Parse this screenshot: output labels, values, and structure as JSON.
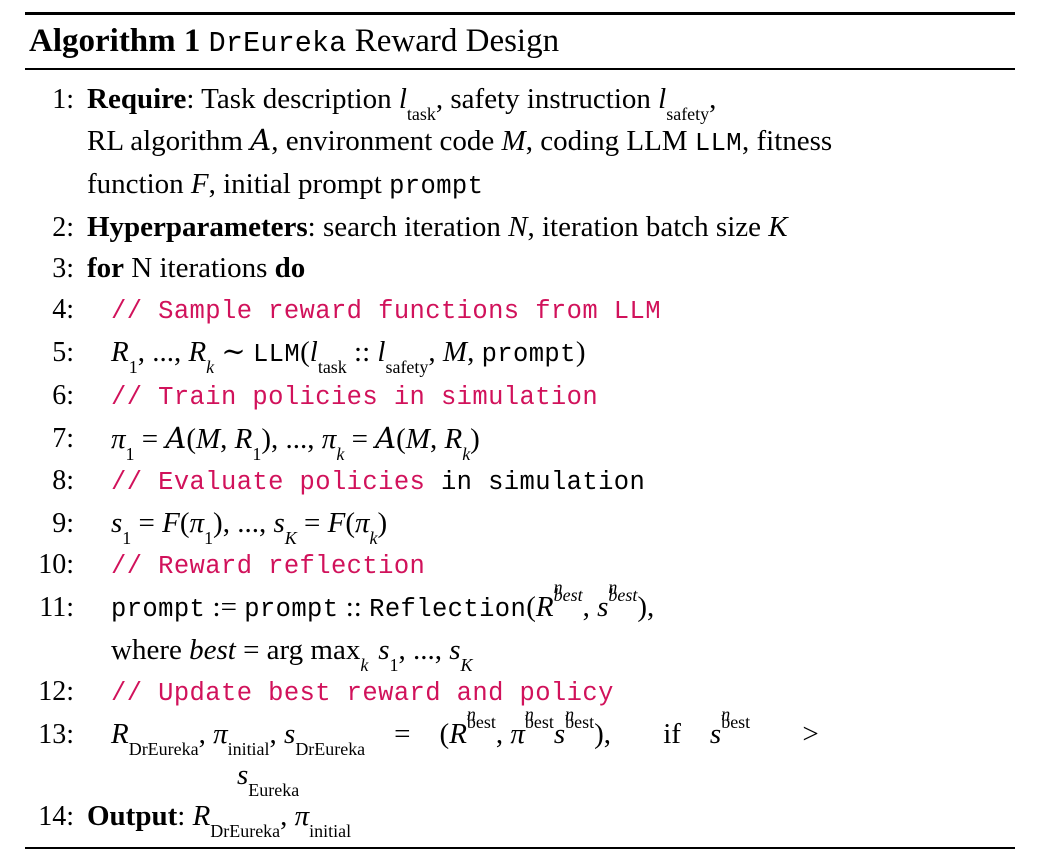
{
  "algorithm": {
    "keyword": "Algorithm",
    "number": "1",
    "name": "DrEureka",
    "title_suffix": "Reward Design",
    "comment_color": "#D1125B",
    "rules": {
      "top": "thick",
      "mid": "medium",
      "bottom": "thin"
    },
    "lines": [
      {
        "num": "1:",
        "type": "require",
        "label": "Require",
        "text_1": ": Task description ",
        "var_l1": "l",
        "sub_l1": "task",
        "text_2": ", safety instruction ",
        "var_l2": "l",
        "sub_l2": "safety",
        "text_3": ",",
        "cont_1_a": "RL algorithm ",
        "cont_1_cal": "A",
        "cont_1_b": ", environment code ",
        "cont_1_M": "M",
        "cont_1_c": ", coding LLM ",
        "cont_1_tt": "LLM",
        "cont_1_d": ", fitness",
        "cont_2_a": "function ",
        "cont_2_F": "F",
        "cont_2_b": ", initial prompt ",
        "cont_2_tt": "prompt"
      },
      {
        "num": "2:",
        "type": "hyperparameters",
        "label": "Hyperparameters",
        "text_1": ": search iteration ",
        "var_N": "N",
        "text_2": ", iteration batch size ",
        "var_K": "K"
      },
      {
        "num": "3:",
        "type": "for",
        "kw_for": "for",
        "text_1": " N iterations ",
        "kw_do": "do"
      },
      {
        "num": "4:",
        "type": "comment",
        "comment": "// Sample reward functions from LLM"
      },
      {
        "num": "5:",
        "type": "math",
        "R": "R",
        "sub_R1": "1",
        "dots": ", ..., ",
        "R2": "R",
        "sub_Rk": "k",
        "sim": " ∼ ",
        "llm": "LLM",
        "paren_open": "(",
        "l1": "l",
        "sub_l1": "task",
        "cc": " :: ",
        "l2": "l",
        "sub_l2": "safety",
        "comma1": ", ",
        "M": "M",
        "comma2": ", ",
        "prompt": "prompt",
        "paren_close": ")"
      },
      {
        "num": "6:",
        "type": "comment",
        "comment": "// Train policies in simulation"
      },
      {
        "num": "7:",
        "type": "math",
        "pi1": "π",
        "sub_pi1": "1",
        "eq1": " = ",
        "cal1": "A",
        "args1": "(",
        "M1": "M",
        "c1": ", ",
        "Rr1": "R",
        "sub_Rr1": "1",
        "cl1": ")",
        "dots": ", ..., ",
        "pik": "π",
        "sub_pik": "k",
        "eq2": " = ",
        "cal2": "A",
        "args2": "(",
        "M2": "M",
        "c2": ", ",
        "Rr2": "R",
        "sub_Rr2": "k",
        "cl2": ")"
      },
      {
        "num": "8:",
        "type": "comment-mixed",
        "comment": "// Evaluate policies",
        "plain": " in simulation"
      },
      {
        "num": "9:",
        "type": "math",
        "s1": "s",
        "sub_s1": "1",
        "eq1": " = ",
        "F1": "F",
        "o1": "(",
        "pi1": "π",
        "sub_pi1": "1",
        "c1": ")",
        "dots": ", ..., ",
        "sK": "s",
        "sub_sK": "K",
        "eq2": " = ",
        "F2": "F",
        "o2": "(",
        "pik": "π",
        "sub_pik": "k",
        "c2": ")"
      },
      {
        "num": "10:",
        "type": "comment",
        "comment": "// Reward reflection"
      },
      {
        "num": "11:",
        "type": "math",
        "prompt_a": "prompt",
        "assign": " := ",
        "prompt_b": "prompt",
        "cc": " :: ",
        "reflection": "Reflection",
        "open": "(",
        "R": "R",
        "sup_R": "n",
        "sub_R": "best",
        "comma": ", ",
        "s": "s",
        "sup_s": "n",
        "sub_s": "best",
        "close": "),",
        "cont_where": "where ",
        "cont_best": "best",
        "cont_eq": " = ",
        "cont_argmax": "arg max",
        "cont_sub_k": "k",
        "cont_s1": "s",
        "cont_sub_1": "1",
        "cont_dots": ", ..., ",
        "cont_sK": "s",
        "cont_sub_K": "K"
      },
      {
        "num": "12:",
        "type": "comment",
        "comment": "// Update best reward and policy"
      },
      {
        "num": "13:",
        "type": "math",
        "R_lhs": "R",
        "sub_R_lhs": "DrEureka",
        "c1": ", ",
        "pi_lhs": "π",
        "sub_pi_lhs": "initial",
        "c2": ", ",
        "s_lhs": "s",
        "sub_s_lhs": "DrEureka",
        "eq": "=",
        "open": "(",
        "R_rhs": "R",
        "sup_R_rhs": "n",
        "sub_R_rhs": "best",
        "c3": ", ",
        "pi_rhs": "π",
        "sup_pi_rhs": "n",
        "sub_pi_rhs": "best",
        "s_rhs": "s",
        "sup_s_rhs": "n",
        "sub_s_rhs": "best",
        "close": "),",
        "if_kw": "if",
        "s_cond": "s",
        "sup_s_cond": "n",
        "sub_s_cond": "best",
        "gt": ">",
        "tail_s": "s",
        "tail_sub": "Eureka"
      },
      {
        "num": "14:",
        "type": "output",
        "label": "Output",
        "text_1": ": ",
        "R": "R",
        "sub_R": "DrEureka",
        "c1": ", ",
        "pi": "π",
        "sub_pi": "initial"
      }
    ]
  }
}
